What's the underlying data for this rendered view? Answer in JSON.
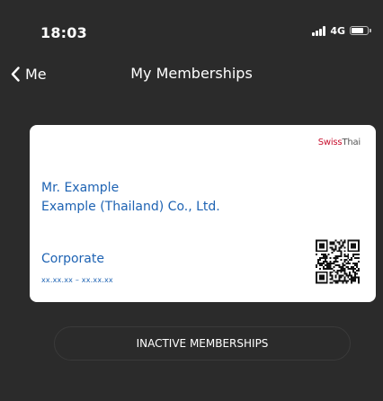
{
  "status_bar": {
    "time": "18:03",
    "network": "4G",
    "battery_level": 0.75
  },
  "nav": {
    "back_label": "Me",
    "title": "My Memberships"
  },
  "card": {
    "brand_part1": "Swiss",
    "brand_part2": "Thai",
    "member_name": "Mr. Example",
    "company": "Example (Thailand) Co., Ltd.",
    "tier": "Corporate",
    "validity": "xx.xx.xx – xx.xx.xx",
    "colors": {
      "text": "#1e63b3",
      "brand_red": "#c8102e"
    }
  },
  "actions": {
    "inactive_label": "INACTIVE MEMBERSHIPS"
  },
  "icons": {
    "back": "chevron-left-icon",
    "signal": "signal-icon",
    "battery": "battery-icon",
    "qr": "qr-code-icon"
  },
  "theme": {
    "background": "#2b2b2b",
    "card": "#ffffff"
  }
}
